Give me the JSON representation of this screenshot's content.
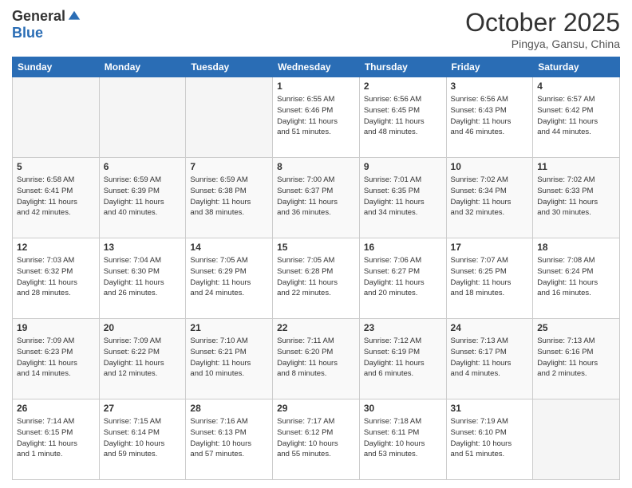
{
  "header": {
    "logo_general": "General",
    "logo_blue": "Blue",
    "month_title": "October 2025",
    "location": "Pingya, Gansu, China"
  },
  "weekdays": [
    "Sunday",
    "Monday",
    "Tuesday",
    "Wednesday",
    "Thursday",
    "Friday",
    "Saturday"
  ],
  "weeks": [
    [
      {
        "day": "",
        "info": ""
      },
      {
        "day": "",
        "info": ""
      },
      {
        "day": "",
        "info": ""
      },
      {
        "day": "1",
        "info": "Sunrise: 6:55 AM\nSunset: 6:46 PM\nDaylight: 11 hours\nand 51 minutes."
      },
      {
        "day": "2",
        "info": "Sunrise: 6:56 AM\nSunset: 6:45 PM\nDaylight: 11 hours\nand 48 minutes."
      },
      {
        "day": "3",
        "info": "Sunrise: 6:56 AM\nSunset: 6:43 PM\nDaylight: 11 hours\nand 46 minutes."
      },
      {
        "day": "4",
        "info": "Sunrise: 6:57 AM\nSunset: 6:42 PM\nDaylight: 11 hours\nand 44 minutes."
      }
    ],
    [
      {
        "day": "5",
        "info": "Sunrise: 6:58 AM\nSunset: 6:41 PM\nDaylight: 11 hours\nand 42 minutes."
      },
      {
        "day": "6",
        "info": "Sunrise: 6:59 AM\nSunset: 6:39 PM\nDaylight: 11 hours\nand 40 minutes."
      },
      {
        "day": "7",
        "info": "Sunrise: 6:59 AM\nSunset: 6:38 PM\nDaylight: 11 hours\nand 38 minutes."
      },
      {
        "day": "8",
        "info": "Sunrise: 7:00 AM\nSunset: 6:37 PM\nDaylight: 11 hours\nand 36 minutes."
      },
      {
        "day": "9",
        "info": "Sunrise: 7:01 AM\nSunset: 6:35 PM\nDaylight: 11 hours\nand 34 minutes."
      },
      {
        "day": "10",
        "info": "Sunrise: 7:02 AM\nSunset: 6:34 PM\nDaylight: 11 hours\nand 32 minutes."
      },
      {
        "day": "11",
        "info": "Sunrise: 7:02 AM\nSunset: 6:33 PM\nDaylight: 11 hours\nand 30 minutes."
      }
    ],
    [
      {
        "day": "12",
        "info": "Sunrise: 7:03 AM\nSunset: 6:32 PM\nDaylight: 11 hours\nand 28 minutes."
      },
      {
        "day": "13",
        "info": "Sunrise: 7:04 AM\nSunset: 6:30 PM\nDaylight: 11 hours\nand 26 minutes."
      },
      {
        "day": "14",
        "info": "Sunrise: 7:05 AM\nSunset: 6:29 PM\nDaylight: 11 hours\nand 24 minutes."
      },
      {
        "day": "15",
        "info": "Sunrise: 7:05 AM\nSunset: 6:28 PM\nDaylight: 11 hours\nand 22 minutes."
      },
      {
        "day": "16",
        "info": "Sunrise: 7:06 AM\nSunset: 6:27 PM\nDaylight: 11 hours\nand 20 minutes."
      },
      {
        "day": "17",
        "info": "Sunrise: 7:07 AM\nSunset: 6:25 PM\nDaylight: 11 hours\nand 18 minutes."
      },
      {
        "day": "18",
        "info": "Sunrise: 7:08 AM\nSunset: 6:24 PM\nDaylight: 11 hours\nand 16 minutes."
      }
    ],
    [
      {
        "day": "19",
        "info": "Sunrise: 7:09 AM\nSunset: 6:23 PM\nDaylight: 11 hours\nand 14 minutes."
      },
      {
        "day": "20",
        "info": "Sunrise: 7:09 AM\nSunset: 6:22 PM\nDaylight: 11 hours\nand 12 minutes."
      },
      {
        "day": "21",
        "info": "Sunrise: 7:10 AM\nSunset: 6:21 PM\nDaylight: 11 hours\nand 10 minutes."
      },
      {
        "day": "22",
        "info": "Sunrise: 7:11 AM\nSunset: 6:20 PM\nDaylight: 11 hours\nand 8 minutes."
      },
      {
        "day": "23",
        "info": "Sunrise: 7:12 AM\nSunset: 6:19 PM\nDaylight: 11 hours\nand 6 minutes."
      },
      {
        "day": "24",
        "info": "Sunrise: 7:13 AM\nSunset: 6:17 PM\nDaylight: 11 hours\nand 4 minutes."
      },
      {
        "day": "25",
        "info": "Sunrise: 7:13 AM\nSunset: 6:16 PM\nDaylight: 11 hours\nand 2 minutes."
      }
    ],
    [
      {
        "day": "26",
        "info": "Sunrise: 7:14 AM\nSunset: 6:15 PM\nDaylight: 11 hours\nand 1 minute."
      },
      {
        "day": "27",
        "info": "Sunrise: 7:15 AM\nSunset: 6:14 PM\nDaylight: 10 hours\nand 59 minutes."
      },
      {
        "day": "28",
        "info": "Sunrise: 7:16 AM\nSunset: 6:13 PM\nDaylight: 10 hours\nand 57 minutes."
      },
      {
        "day": "29",
        "info": "Sunrise: 7:17 AM\nSunset: 6:12 PM\nDaylight: 10 hours\nand 55 minutes."
      },
      {
        "day": "30",
        "info": "Sunrise: 7:18 AM\nSunset: 6:11 PM\nDaylight: 10 hours\nand 53 minutes."
      },
      {
        "day": "31",
        "info": "Sunrise: 7:19 AM\nSunset: 6:10 PM\nDaylight: 10 hours\nand 51 minutes."
      },
      {
        "day": "",
        "info": ""
      }
    ]
  ]
}
